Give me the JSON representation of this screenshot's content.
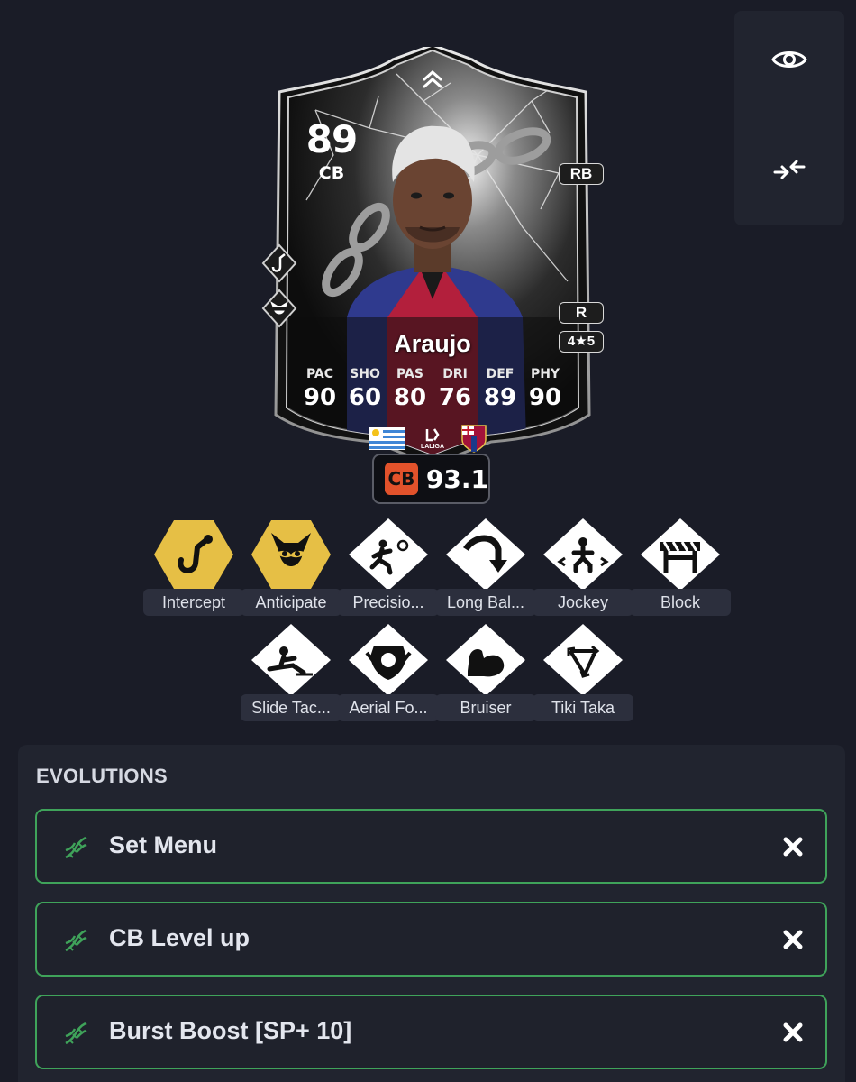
{
  "card": {
    "rating": "89",
    "position": "CB",
    "alt_position": "RB",
    "preferred_foot": "R",
    "skill_weak": "4★5",
    "name": "Araujo",
    "stats": [
      {
        "label": "PAC",
        "value": "90"
      },
      {
        "label": "SHO",
        "value": "60"
      },
      {
        "label": "PAS",
        "value": "80"
      },
      {
        "label": "DRI",
        "value": "76"
      },
      {
        "label": "DEF",
        "value": "89"
      },
      {
        "label": "PHY",
        "value": "90"
      }
    ],
    "league_text": "LALIGA"
  },
  "position_rating": {
    "position": "CB",
    "value": "93.1",
    "accent": "#e2522b"
  },
  "playstyles": [
    {
      "label": "Intercept",
      "plus": true,
      "icon": "hook-icon"
    },
    {
      "label": "Anticipate",
      "plus": true,
      "icon": "raccoon-icon"
    },
    {
      "label": "Precisio...",
      "plus": false,
      "icon": "precision-pass-icon"
    },
    {
      "label": "Long Bal...",
      "plus": false,
      "icon": "long-ball-icon"
    },
    {
      "label": "Jockey",
      "plus": false,
      "icon": "jockey-icon"
    },
    {
      "label": "Block",
      "plus": false,
      "icon": "block-icon"
    },
    {
      "label": "Slide Tac...",
      "plus": false,
      "icon": "slide-tackle-icon"
    },
    {
      "label": "Aerial Fo...",
      "plus": false,
      "icon": "aerial-icon"
    },
    {
      "label": "Bruiser",
      "plus": false,
      "icon": "bruiser-icon"
    },
    {
      "label": "Tiki Taka",
      "plus": false,
      "icon": "tiki-taka-icon"
    }
  ],
  "evolutions": {
    "title": "EVOLUTIONS",
    "items": [
      {
        "name": "Set Menu"
      },
      {
        "name": "CB Level up"
      },
      {
        "name": "Burst Boost [SP+ 10]"
      }
    ]
  },
  "colors": {
    "background": "#1a1c27",
    "panel": "#21242f",
    "evolution_border": "#3fa35a",
    "playstyle_plus": "#e6bf45"
  }
}
